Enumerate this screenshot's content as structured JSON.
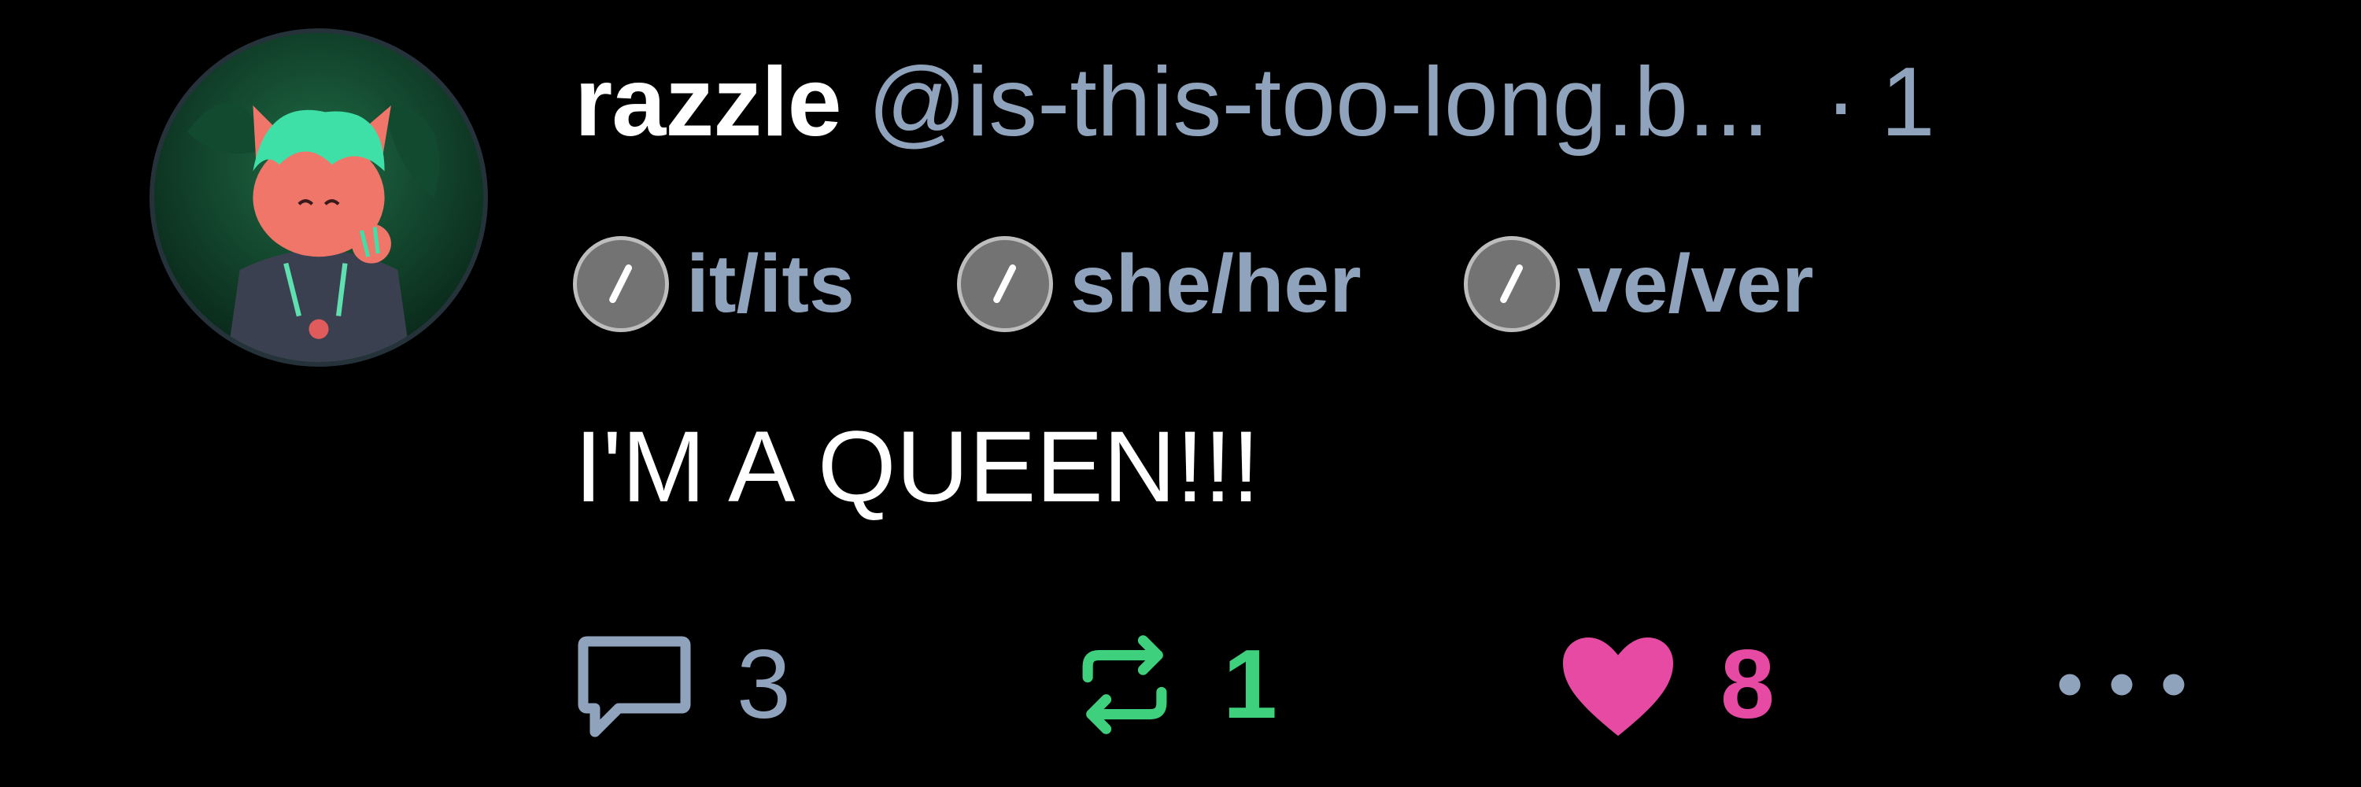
{
  "post": {
    "author": {
      "display_name": "razzle",
      "handle": "@is-this-too-long.b...",
      "separator": "·",
      "timestamp_partial": "1"
    },
    "pronouns": [
      {
        "label": "it/its",
        "icon": "pronoun-slash-icon"
      },
      {
        "label": "she/her",
        "icon": "pronoun-slash-icon"
      },
      {
        "label": "ve/ver",
        "icon": "pronoun-slash-icon"
      }
    ],
    "text": "I'M A QUEEN!!!",
    "actions": {
      "reply": {
        "count": "3",
        "icon": "reply-bubble-icon",
        "color": "#8fa3bd"
      },
      "repost": {
        "count": "1",
        "icon": "repost-icon",
        "color": "#3fd07e"
      },
      "like": {
        "count": "8",
        "icon": "heart-icon",
        "color": "#e64aa3"
      },
      "more": {
        "icon": "more-dots-icon",
        "color": "#8fa3bd"
      }
    }
  }
}
